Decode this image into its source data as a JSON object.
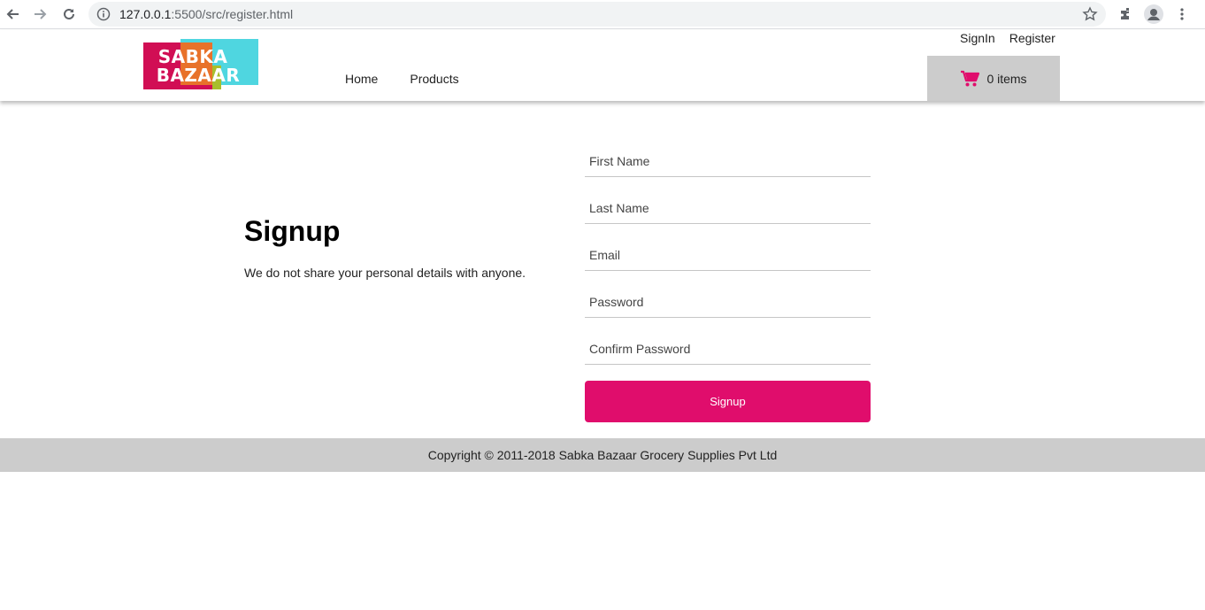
{
  "browser": {
    "url_host": "127.0.0.1",
    "url_rest": ":5500/src/register.html",
    "icons": [
      "back-icon",
      "forward-icon",
      "reload-icon",
      "info-icon",
      "star-icon",
      "extensions-icon",
      "profile-icon",
      "menu-icon"
    ]
  },
  "header": {
    "logo_line1": "SABKA",
    "logo_line2": "BAZAAR",
    "nav": {
      "home": "Home",
      "products": "Products"
    },
    "top_links": {
      "signin": "SignIn",
      "register": "Register"
    },
    "cart_label": "0 items",
    "colors": {
      "brand_pink": "#d10e54",
      "brand_cyan": "#4fd6e0",
      "cart_bg": "#cccccc"
    }
  },
  "main": {
    "title": "Signup",
    "subtitle": "We do not share your personal details with anyone.",
    "form": {
      "first_name_placeholder": "First Name",
      "last_name_placeholder": "Last Name",
      "email_placeholder": "Email",
      "password_placeholder": "Password",
      "confirm_password_placeholder": "Confirm Password",
      "submit_label": "Signup",
      "submit_color": "#e00d6c"
    }
  },
  "footer": {
    "copyright": "Copyright © 2011-2018 Sabka Bazaar Grocery Supplies Pvt Ltd"
  }
}
